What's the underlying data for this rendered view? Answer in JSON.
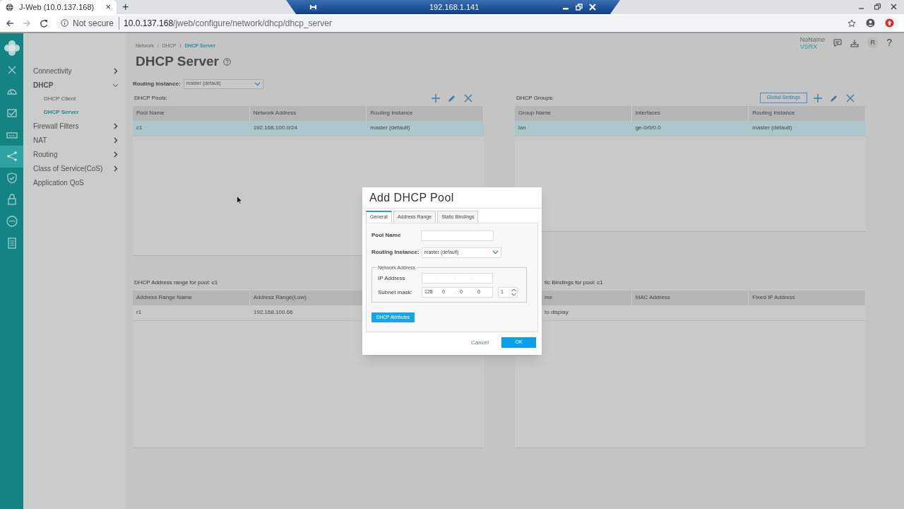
{
  "browser": {
    "tabs": [
      {
        "title": "J-Web (10.0.137.168)",
        "selected": true
      }
    ],
    "new_tab": "+",
    "close_tab": "×",
    "remote_bar": {
      "title": "192.168.1.141"
    },
    "address": {
      "security": "Not secure",
      "host": "10.0.137.168",
      "path": "/jweb/configure/network/dhcp/dhcp_server"
    }
  },
  "rail": [
    {
      "kind": "logo",
      "selected": false
    },
    {
      "kind": "close",
      "selected": false
    },
    {
      "kind": "dashboard",
      "selected": false
    },
    {
      "kind": "monitor",
      "selected": false
    },
    {
      "kind": "device",
      "selected": false
    },
    {
      "kind": "network",
      "selected": true
    },
    {
      "kind": "shield",
      "selected": false
    },
    {
      "kind": "lock",
      "selected": false
    },
    {
      "kind": "vpn",
      "selected": false
    },
    {
      "kind": "report",
      "selected": false
    }
  ],
  "sidebar": {
    "items": [
      {
        "label": "Connectivity",
        "expanded": false,
        "has_children": true
      },
      {
        "label": "DHCP",
        "expanded": true,
        "has_children": true,
        "children": [
          {
            "label": "DHCP Client",
            "selected": false
          },
          {
            "label": "DHCP Server",
            "selected": true
          }
        ]
      },
      {
        "label": "Firewall Filters",
        "expanded": false,
        "has_children": true
      },
      {
        "label": "NAT",
        "expanded": false,
        "has_children": true
      },
      {
        "label": "Routing",
        "expanded": false,
        "has_children": true
      },
      {
        "label": "Class of Service(CoS)",
        "expanded": false,
        "has_children": true
      },
      {
        "label": "Application QoS",
        "expanded": false,
        "has_children": false
      }
    ]
  },
  "header": {
    "device_name": "NoName",
    "model": "VSRX",
    "avatar": "R",
    "help": "?"
  },
  "breadcrumb": {
    "separator": "/",
    "items": [
      "Network",
      "DHCP",
      "DHCP Server"
    ]
  },
  "title": "DHCP Server",
  "routing_instance": {
    "label": "Routing Instance:",
    "value": "master (default)"
  },
  "pools": {
    "label": "DHCP Pools:",
    "columns": [
      "Pool Name",
      "Network Address",
      "Routing Instance"
    ],
    "rows": [
      {
        "cells": [
          "c1",
          "192.168.100.0/24",
          "master (default)"
        ],
        "selected": true
      }
    ]
  },
  "groups": {
    "label": "DHCP Groups:",
    "button": "Global Settings",
    "columns": [
      "Group Name",
      "Interfaces",
      "Routing Instance"
    ],
    "rows": [
      {
        "cells": [
          "lan",
          "ge-0/0/0.0",
          "master (default)"
        ],
        "selected": true
      }
    ]
  },
  "ranges": {
    "label": "DHCP Address range for pool: c1",
    "columns": [
      "Address Range Name",
      "Address Range(Low)"
    ],
    "rows": [
      {
        "cells": [
          "r1",
          "192.168.100.66"
        ],
        "selected": false
      }
    ]
  },
  "bindings": {
    "label": "tic Bindings for pool: c1",
    "columns": [
      "me",
      "MAC Address",
      "Fixed IP Address"
    ],
    "rows": [
      {
        "cells": [
          "to display"
        ],
        "selected": false
      }
    ]
  },
  "dialog": {
    "title": "Add DHCP Pool",
    "tabs": [
      {
        "label": "General",
        "selected": true
      },
      {
        "label": "Address Range",
        "selected": false
      },
      {
        "label": "Static Bindings",
        "selected": false
      }
    ],
    "pool_name_label": "Pool Name",
    "routing_label": "Routing Instance:",
    "routing_value": "master (default)",
    "legend": "Network Address",
    "ip_label": "IP Address",
    "mask_label": "Subnet mask:",
    "octet_separator": ".",
    "mask_octets": [
      "128",
      "0",
      "0",
      "0"
    ],
    "prefix": "1",
    "attributes_button": "DHCP Attributes",
    "cancel": "Cancel",
    "ok": "OK"
  }
}
